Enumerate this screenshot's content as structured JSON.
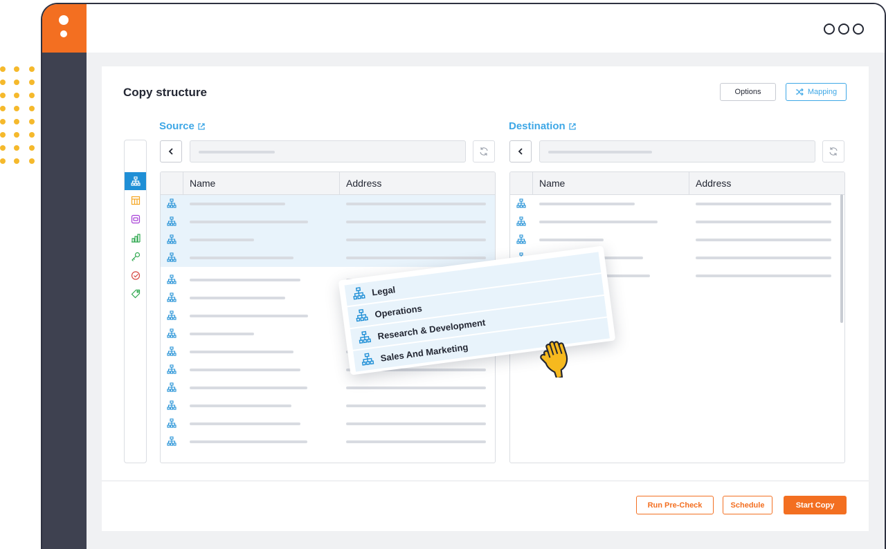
{
  "app": {
    "window_menu_icon": "ellipsis-icon",
    "colors": {
      "accent_orange": "#f36f21",
      "accent_blue": "#3ea7e6",
      "sidebar_dark": "#3e4150",
      "dot_yellow": "#f5b92c"
    }
  },
  "page": {
    "title": "Copy structure"
  },
  "header_buttons": {
    "options_label": "Options",
    "mapping_label": "Mapping"
  },
  "tools": [
    {
      "icon": "org-chart-icon",
      "active": true
    },
    {
      "icon": "table-icon",
      "active": false
    },
    {
      "icon": "storage-icon",
      "active": false
    },
    {
      "icon": "chart-icon",
      "active": false
    },
    {
      "icon": "key-icon",
      "active": false
    },
    {
      "icon": "check-badge-icon",
      "active": false
    },
    {
      "icon": "tag-icon",
      "active": false
    }
  ],
  "source": {
    "label": "Source",
    "columns": [
      "Name",
      "Address"
    ],
    "row_count": 14,
    "selected_rows": 4
  },
  "destination": {
    "label": "Destination",
    "columns": [
      "Name",
      "Address"
    ],
    "row_count": 5
  },
  "drag_items": [
    "Legal",
    "Operations",
    "Research & Development",
    "Sales And Marketing"
  ],
  "footer": {
    "precheck_label": "Run Pre-Check",
    "schedule_label": "Schedule",
    "start_label": "Start Copy"
  }
}
